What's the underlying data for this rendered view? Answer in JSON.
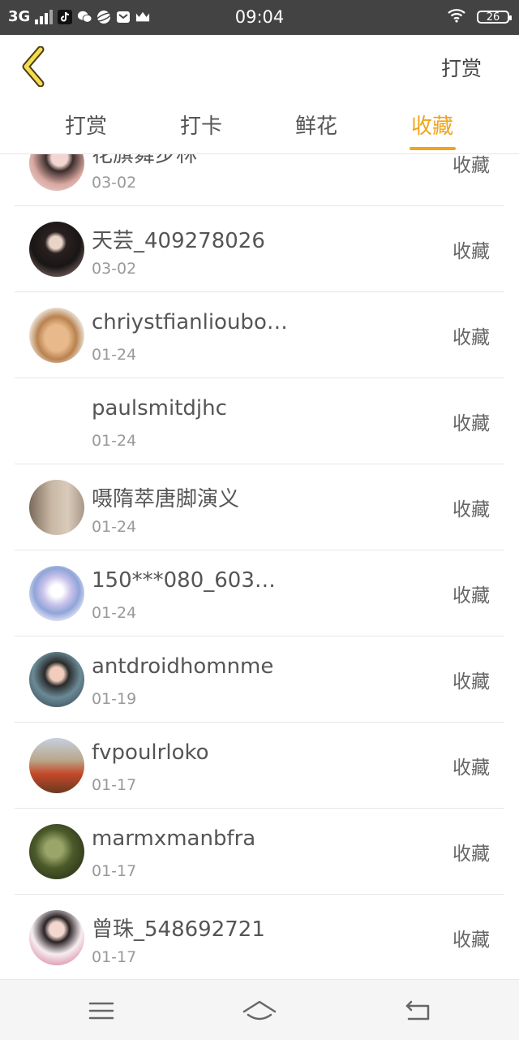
{
  "status_bar": {
    "network": "3G",
    "time": "09:04",
    "battery": "26"
  },
  "header": {
    "action_label": "打赏"
  },
  "tabs": [
    {
      "label": "打赏"
    },
    {
      "label": "打卡"
    },
    {
      "label": "鲜花"
    },
    {
      "label": "收藏"
    }
  ],
  "active_tab": 3,
  "accent_color": "#f0a51a",
  "list": [
    {
      "name": "花旗舞步林",
      "date": "03-02",
      "action": "收藏"
    },
    {
      "name": "天芸_409278026",
      "date": "03-02",
      "action": "收藏"
    },
    {
      "name": "chriystfianlioubo…",
      "date": "01-24",
      "action": "收藏"
    },
    {
      "name": "paulsmitdjhc",
      "date": "01-24",
      "action": "收藏"
    },
    {
      "name": "嗫隋萃唐脚演义",
      "date": "01-24",
      "action": "收藏"
    },
    {
      "name": "150***080_603…",
      "date": "01-24",
      "action": "收藏"
    },
    {
      "name": "antdroidhomnme",
      "date": "01-19",
      "action": "收藏"
    },
    {
      "name": "fvpoulrloko",
      "date": "01-17",
      "action": "收藏"
    },
    {
      "name": "marmxmanbfra",
      "date": "01-17",
      "action": "收藏"
    },
    {
      "name": "曾珠_548692721",
      "date": "01-17",
      "action": "收藏"
    }
  ],
  "nav": {
    "icons": [
      "menu-icon",
      "home-icon",
      "back-icon"
    ]
  }
}
